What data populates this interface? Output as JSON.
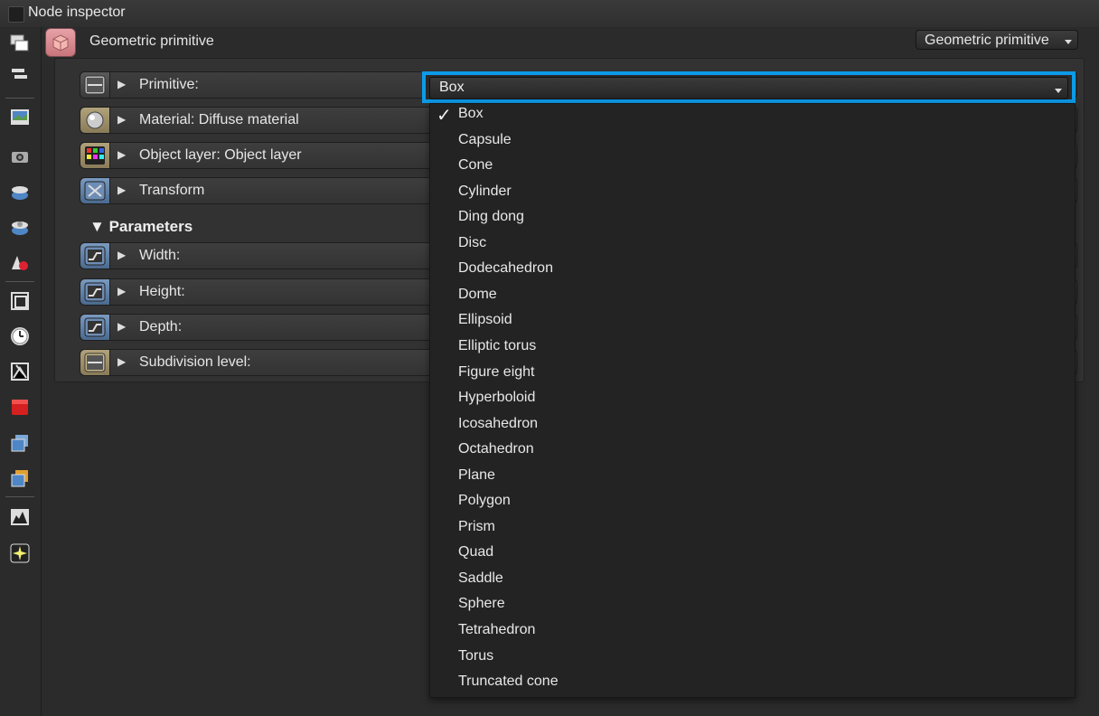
{
  "window": {
    "title": "Node inspector"
  },
  "node": {
    "name": "Geometric primitive",
    "type_select": "Geometric primitive"
  },
  "attributes": [
    {
      "label": "Primitive:",
      "icon": "enum-icon"
    },
    {
      "label": "Material: Diffuse material",
      "icon": "material-sphere-icon"
    },
    {
      "label": "Object layer: Object layer",
      "icon": "object-layer-icon"
    },
    {
      "label": "Transform",
      "icon": "transform-icon"
    }
  ],
  "parameters": {
    "header": "Parameters",
    "items": [
      {
        "label": "Width:",
        "icon": "float-curve-icon"
      },
      {
        "label": "Height:",
        "icon": "float-curve-icon"
      },
      {
        "label": "Depth:",
        "icon": "float-curve-icon"
      },
      {
        "label": "Subdivision level:",
        "icon": "enum-icon"
      }
    ]
  },
  "primitive_select": {
    "value": "Box",
    "options": [
      "Box",
      "Capsule",
      "Cone",
      "Cylinder",
      "Ding dong",
      "Disc",
      "Dodecahedron",
      "Dome",
      "Ellipsoid",
      "Elliptic torus",
      "Figure eight",
      "Hyperboloid",
      "Icosahedron",
      "Octahedron",
      "Plane",
      "Polygon",
      "Prism",
      "Quad",
      "Saddle",
      "Sphere",
      "Tetrahedron",
      "Torus",
      "Truncated cone"
    ],
    "checked_mark": "✓"
  },
  "toolbar_icons": [
    "windows-icon",
    "list-icon",
    "image-icon",
    "camera-icon",
    "environment-icon",
    "kernel-icon",
    "shapes-icon",
    "crop-icon",
    "clock-icon",
    "texture-icon",
    "red-cube-icon",
    "layers-icon",
    "stacked-boxes-icon",
    "histogram-icon",
    "star-burst-icon"
  ],
  "colors": {
    "highlight": "#0d9ae8",
    "background": "#2b2b2b"
  }
}
